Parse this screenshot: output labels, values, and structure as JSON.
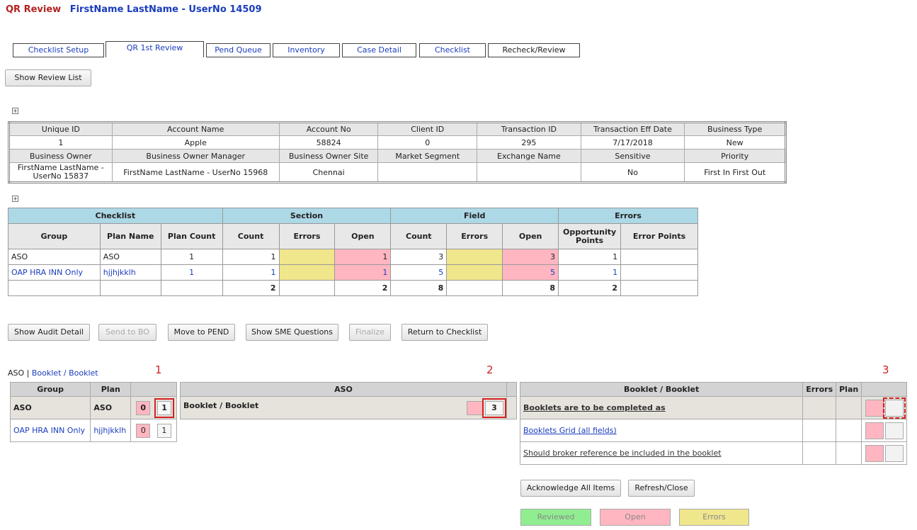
{
  "header": {
    "app": "QR Review",
    "user": "FirstName LastName - UserNo 14509"
  },
  "tabs": [
    {
      "label": "Checklist Setup"
    },
    {
      "label": "QR 1st Review"
    },
    {
      "label": "Pend Queue"
    },
    {
      "label": "Inventory"
    },
    {
      "label": "Case Detail"
    },
    {
      "label": "Checklist"
    },
    {
      "label": "Recheck/Review"
    }
  ],
  "show_review_list": "Show Review List",
  "expand_symbol": "+",
  "info": {
    "row1_headers": [
      "Unique ID",
      "Account Name",
      "Account No",
      "Client ID",
      "Transaction ID",
      "Transaction Eff Date",
      "Business Type"
    ],
    "row1_values": [
      "1",
      "Apple",
      "58824",
      "0",
      "295",
      "7/17/2018",
      "New"
    ],
    "row2_headers": [
      "Business Owner",
      "Business Owner Manager",
      "Business Owner Site",
      "Market Segment",
      "Exchange Name",
      "Sensitive",
      "Priority"
    ],
    "row2_values": [
      "FirstName LastName - UserNo 15837",
      "FirstName LastName - UserNo 15968",
      "Chennai",
      "",
      "",
      "No",
      "First In First Out"
    ]
  },
  "summary": {
    "groups": [
      "Checklist",
      "Section",
      "Field",
      "Errors"
    ],
    "columns": [
      "Group",
      "Plan Name",
      "Plan Count",
      "Count",
      "Errors",
      "Open",
      "Count",
      "Errors",
      "Open",
      "Opportunity Points",
      "Error Points"
    ],
    "rows": [
      [
        "ASO",
        "ASO",
        "1",
        "1",
        "",
        "1",
        "3",
        "",
        "3",
        "1",
        ""
      ],
      [
        "OAP HRA INN Only",
        "hjjhjkklh",
        "1",
        "1",
        "",
        "1",
        "5",
        "",
        "5",
        "1",
        ""
      ]
    ],
    "totals": [
      "",
      "",
      "",
      "2",
      "",
      "2",
      "8",
      "",
      "8",
      "2",
      ""
    ]
  },
  "actions": {
    "show_audit_detail": "Show Audit Detail",
    "send_to_bo": "Send to BO",
    "move_to_pend": "Move to PEND",
    "show_sme_questions": "Show SME Questions",
    "finalize": "Finalize",
    "return_to_checklist": "Return to Checklist"
  },
  "breadcrumb": {
    "group": "ASO",
    "sep": " | ",
    "link": "Booklet / Booklet"
  },
  "annotations": [
    "1",
    "2",
    "3"
  ],
  "left_table": {
    "headers": [
      "Group",
      "Plan",
      ""
    ],
    "rows": [
      {
        "group": "ASO",
        "plan": "ASO",
        "a": "0",
        "b": "1"
      },
      {
        "group": "OAP HRA INN Only",
        "plan": "hjjhjkklh",
        "a": "0",
        "b": "1"
      }
    ]
  },
  "mid_table": {
    "header": "ASO",
    "row_label": "Booklet / Booklet",
    "count": "3"
  },
  "right_table": {
    "headers": [
      "Booklet / Booklet",
      "Errors",
      "Plan",
      ""
    ],
    "rows": [
      {
        "label": "Booklets are to be completed as"
      },
      {
        "label": "Booklets Grid (all fields)"
      },
      {
        "label": "Should broker reference be included in the booklet"
      }
    ]
  },
  "right_actions": {
    "acknowledge": "Acknowledge All Items",
    "refresh": "Refresh/Close"
  },
  "legend": {
    "reviewed": "Reviewed",
    "open": "Open",
    "errors": "Errors"
  },
  "colors": {
    "section_header": "#add8e6",
    "errors_yellow": "#f0e68c",
    "open_pink": "#ffb6c1",
    "reviewed_green": "#90ee90"
  }
}
